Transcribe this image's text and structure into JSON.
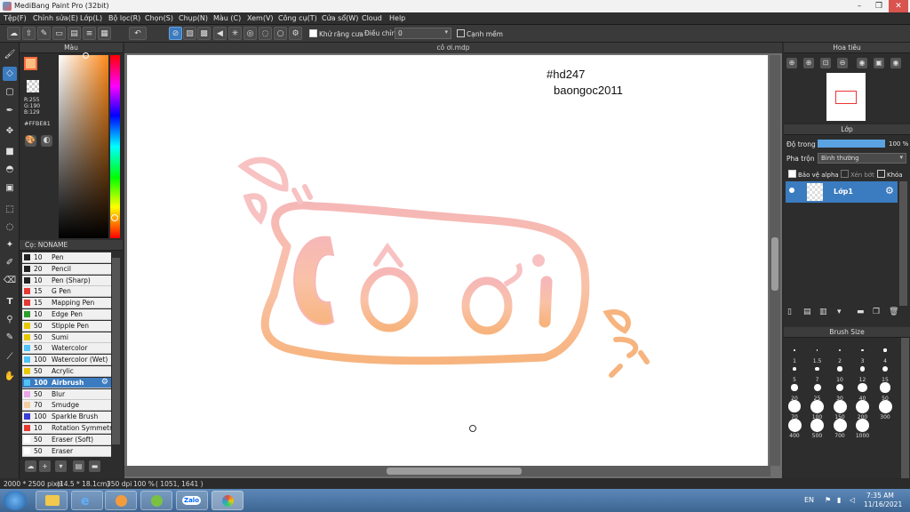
{
  "window": {
    "title": "MediBang Paint Pro (32bit)"
  },
  "menu": [
    "Tệp(F)",
    "Chỉnh sửa(E)",
    "Lớp(L)",
    "Bộ lọc(R)",
    "Chọn(S)",
    "Chụp(N)",
    "Màu (C)",
    "Xem(V)",
    "Công cụ(T)",
    "Cửa sổ(W)",
    "Cloud",
    "Help"
  ],
  "toolbar": {
    "antialias_label": "Khử răng cưa",
    "adjust_label": "Điều chỉnh",
    "adjust_value": "0",
    "soft_edge_label": "Cạnh mềm"
  },
  "color_panel": {
    "title": "Màu",
    "rgb": "R:255\nG:190\nB:129",
    "hex": "#FFBE81"
  },
  "brush_panel": {
    "title": "Cọ: NONAME",
    "brushes": [
      {
        "size": "10",
        "name": "Pen",
        "color": "#222222"
      },
      {
        "size": "20",
        "name": "Pencil",
        "color": "#222222"
      },
      {
        "size": "10",
        "name": "Pen (Sharp)",
        "color": "#222222"
      },
      {
        "size": "15",
        "name": "G Pen",
        "color": "#e53935"
      },
      {
        "size": "15",
        "name": "Mapping Pen",
        "color": "#e53935"
      },
      {
        "size": "10",
        "name": "Edge Pen",
        "color": "#2e9e2e"
      },
      {
        "size": "50",
        "name": "Stipple Pen",
        "color": "#e8c800"
      },
      {
        "size": "50",
        "name": "Sumi",
        "color": "#e8c800"
      },
      {
        "size": "50",
        "name": "Watercolor",
        "color": "#4fc3f7"
      },
      {
        "size": "100",
        "name": "Watercolor (Wet)",
        "color": "#4fc3f7"
      },
      {
        "size": "50",
        "name": "Acrylic",
        "color": "#e8c800"
      },
      {
        "size": "100",
        "name": "Airbrush",
        "color": "#4fc3f7"
      },
      {
        "size": "50",
        "name": "Blur",
        "color": "#e8a6e8"
      },
      {
        "size": "70",
        "name": "Smudge",
        "color": "#f5cfa0"
      },
      {
        "size": "100",
        "name": "Sparkle Brush",
        "color": "#3b3bd6"
      },
      {
        "size": "10",
        "name": "Rotation Symmetry",
        "color": "#e53935"
      },
      {
        "size": "50",
        "name": "Eraser (Soft)",
        "color": "#ffffff"
      },
      {
        "size": "50",
        "name": "Eraser",
        "color": "#ffffff"
      }
    ]
  },
  "document": {
    "tab": "cô ơi.mdp",
    "text_hash": "#hd247",
    "text_user": "baongoc2011",
    "art_text_1": "Cô",
    "art_text_2": "ơi"
  },
  "navigator": {
    "title": "Hoa tiêu"
  },
  "layer_panel": {
    "title": "Lớp",
    "opacity_label": "Độ trong",
    "opacity_value": "100 %",
    "opacity_fraction": 1.0,
    "blend_label": "Pha trộn",
    "blend_value": "Bình thường",
    "protect_alpha": "Bảo vệ alpha",
    "clipping": "Xén bớt",
    "lock": "Khóa",
    "layer_name": "Lớp1"
  },
  "brush_size_panel": {
    "title": "Brush Size",
    "sizes": [
      "1",
      "1.5",
      "2",
      "3",
      "4",
      "5",
      "7",
      "10",
      "12",
      "15",
      "20",
      "25",
      "30",
      "40",
      "50",
      "70",
      "100",
      "150",
      "200",
      "300",
      "400",
      "500",
      "700",
      "1000"
    ]
  },
  "status": {
    "dims": "2000 * 2500 pixel",
    "size_cm": "(14.5 * 18.1cm)",
    "dpi": "350 dpi",
    "zoom": "100 %",
    "coords": "( 1051, 1641 )"
  },
  "taskbar": {
    "lang": "EN",
    "time": "7:35 AM",
    "date": "11/16/2021",
    "zalo_label": "Zalo"
  },
  "colors": {
    "main": "#FFBE81",
    "accent": "#3b7bbf",
    "art_pink": "#f6b7b7",
    "art_orange": "#f7ba86"
  }
}
